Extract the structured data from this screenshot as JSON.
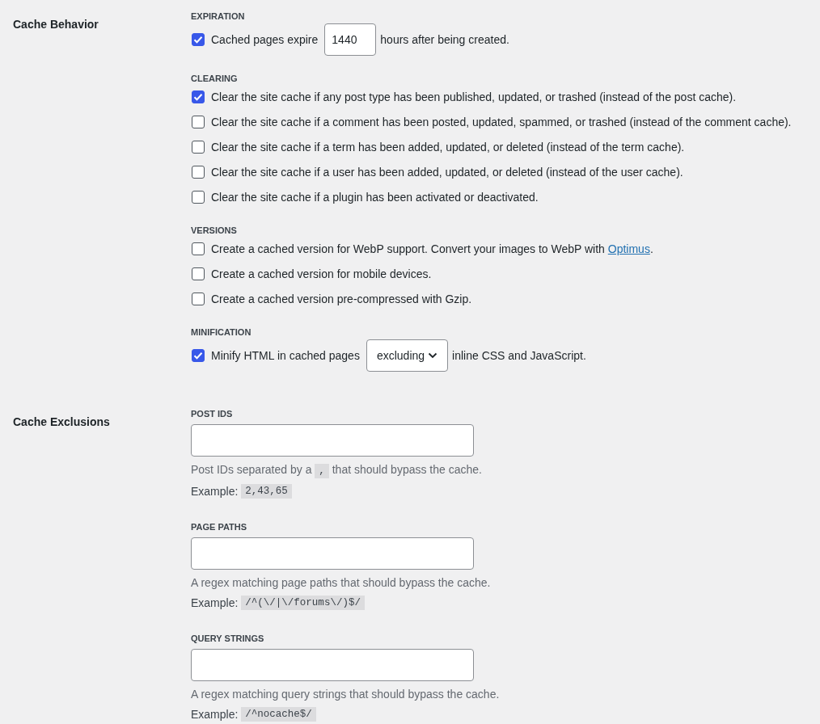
{
  "sections": [
    {
      "title": "Cache Behavior",
      "groups": [
        {
          "heading": "EXPIRATION",
          "options": [
            {
              "kind": "number",
              "checked": true,
              "text": "Cached pages expire",
              "value": "1440",
              "text_after": "hours after being created."
            }
          ]
        },
        {
          "heading": "CLEARING",
          "options": [
            {
              "kind": "plain",
              "checked": true,
              "text": "Clear the site cache if any post type has been published, updated, or trashed (instead of the post cache)."
            },
            {
              "kind": "plain",
              "checked": false,
              "text": "Clear the site cache if a comment has been posted, updated, spammed, or trashed (instead of the comment cache)."
            },
            {
              "kind": "plain",
              "checked": false,
              "text": "Clear the site cache if a term has been added, updated, or deleted (instead of the term cache)."
            },
            {
              "kind": "plain",
              "checked": false,
              "text": "Clear the site cache if a user has been added, updated, or deleted (instead of the user cache)."
            },
            {
              "kind": "plain",
              "checked": false,
              "text": "Clear the site cache if a plugin has been activated or deactivated."
            }
          ]
        },
        {
          "heading": "VERSIONS",
          "options": [
            {
              "kind": "link",
              "checked": false,
              "text": "Create a cached version for WebP support. Convert your images to WebP with",
              "link": "Optimus",
              "text_after": "."
            },
            {
              "kind": "plain",
              "checked": false,
              "text": "Create a cached version for mobile devices."
            },
            {
              "kind": "plain",
              "checked": false,
              "text": "Create a cached version pre-compressed with Gzip."
            }
          ]
        },
        {
          "heading": "MINIFICATION",
          "options": [
            {
              "kind": "select",
              "checked": true,
              "text": "Minify HTML in cached pages",
              "value": "excluding",
              "text_after": "inline CSS and JavaScript."
            }
          ]
        }
      ]
    },
    {
      "title": "Cache Exclusions",
      "fields": [
        {
          "heading": "POST IDS",
          "description": [
            {
              "kind": "text",
              "text": "Post IDs separated by a"
            },
            {
              "kind": "code",
              "text": ","
            },
            {
              "kind": "text",
              "text": "that should bypass the cache."
            }
          ],
          "example_label": "Example:",
          "example": "2,43,65"
        },
        {
          "heading": "PAGE PATHS",
          "description": [
            {
              "kind": "text",
              "text": "A regex matching page paths that should bypass the cache."
            }
          ],
          "example_label": "Example:",
          "example": "/^(\\/|\\/forums\\/)$/"
        },
        {
          "heading": "QUERY STRINGS",
          "description": [
            {
              "kind": "text",
              "text": "A regex matching query strings that should bypass the cache."
            }
          ],
          "example_label": "Example:",
          "example": "/^nocache$/"
        }
      ]
    }
  ]
}
